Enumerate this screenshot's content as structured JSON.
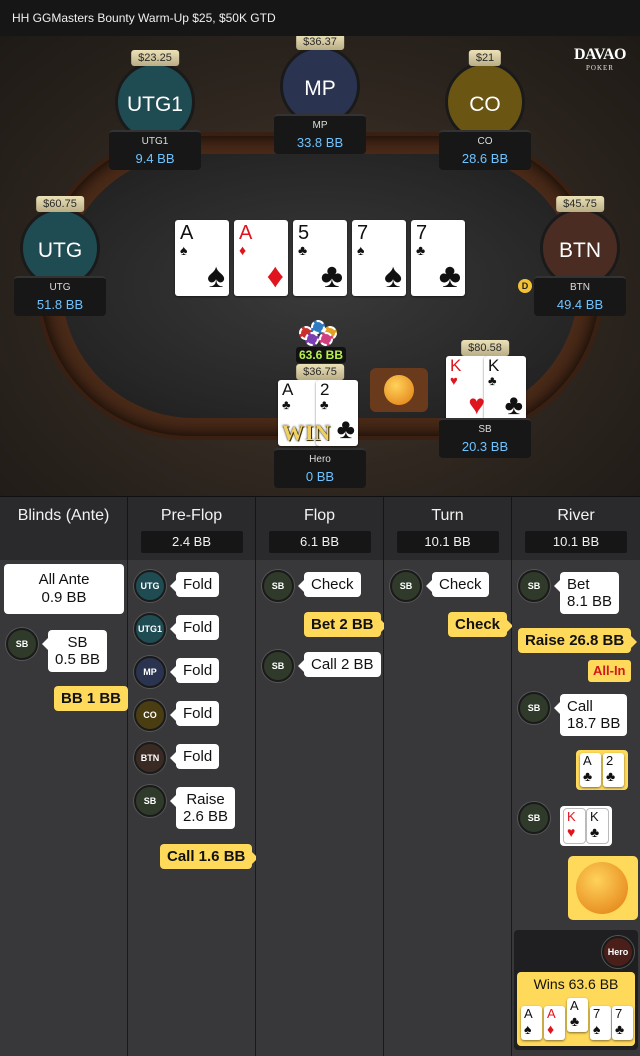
{
  "title": "HH  GGMasters Bounty Warm-Up $25, $50K GTD",
  "logo": {
    "line1": "DAVAO",
    "line2": "POKER"
  },
  "colors": {
    "accent_yellow": "#ffd95a",
    "bb_blue": "#6ec4ff",
    "pot_green": "#b8f04e",
    "allin_red": "#d01818"
  },
  "seats": {
    "utg1": {
      "avatar": "UTG1",
      "stack": "$23.25",
      "name": "UTG1",
      "bb": "9.4 BB",
      "color": "#1f4b52"
    },
    "mp": {
      "avatar": "MP",
      "stack": "$36.37",
      "name": "MP",
      "bb": "33.8 BB",
      "color": "#2a3350"
    },
    "co": {
      "avatar": "CO",
      "stack": "$21",
      "name": "CO",
      "bb": "28.6 BB",
      "color": "#6a5512"
    },
    "utg": {
      "avatar": "UTG",
      "stack": "$60.75",
      "name": "UTG",
      "bb": "51.8 BB",
      "color": "#1f4b52"
    },
    "btn": {
      "avatar": "BTN",
      "stack": "$45.75",
      "name": "BTN",
      "bb": "49.4 BB",
      "color": "#4a2c22"
    },
    "hero": {
      "stack": "$36.75",
      "name": "Hero",
      "bb": "0 BB"
    },
    "sb": {
      "stack": "$80.58",
      "name": "SB",
      "bb": "20.3 BB"
    }
  },
  "dealer_button": "D",
  "board": [
    {
      "rank": "A",
      "suit": "♠",
      "color": "black"
    },
    {
      "rank": "A",
      "suit": "♦",
      "color": "red"
    },
    {
      "rank": "5",
      "suit": "♣",
      "color": "black"
    },
    {
      "rank": "7",
      "suit": "♠",
      "color": "black"
    },
    {
      "rank": "7",
      "suit": "♣",
      "color": "black"
    }
  ],
  "pot": "63.6 BB",
  "hero_cards": [
    {
      "rank": "A",
      "suit": "♣"
    },
    {
      "rank": "2",
      "suit": "♣"
    }
  ],
  "hero_badge": "WIN",
  "sb_cards": [
    {
      "rank": "K",
      "suit": "♥"
    },
    {
      "rank": "K",
      "suit": "♣"
    }
  ],
  "streets": [
    {
      "name": "Blinds (Ante)",
      "pot": ""
    },
    {
      "name": "Pre-Flop",
      "pot": "2.4 BB"
    },
    {
      "name": "Flop",
      "pot": "6.1 BB"
    },
    {
      "name": "Turn",
      "pot": "10.1 BB"
    },
    {
      "name": "River",
      "pot": "10.1 BB"
    }
  ],
  "actions": {
    "blinds": {
      "all_ante_line1": "All Ante",
      "all_ante_line2": "0.9 BB",
      "sb_badge": "SB",
      "sb_line1": "SB",
      "sb_line2": "0.5 BB",
      "bb": "BB 1 BB"
    },
    "preflop": {
      "utg": "UTG",
      "utg_act": "Fold",
      "utg1": "UTG1",
      "utg1_act": "Fold",
      "mp": "MP",
      "mp_act": "Fold",
      "co": "CO",
      "co_act": "Fold",
      "btn": "BTN",
      "btn_act": "Fold",
      "sb": "SB",
      "sb_line1": "Raise",
      "sb_line2": "2.6 BB",
      "hero_act": "Call 1.6 BB"
    },
    "flop": {
      "sb1": "SB",
      "sb1_act": "Check",
      "hero_act": "Bet 2 BB",
      "sb2": "SB",
      "sb2_act": "Call 2 BB"
    },
    "turn": {
      "sb": "SB",
      "sb_act": "Check",
      "hero_act": "Check"
    },
    "river": {
      "sb1": "SB",
      "sb1_line1": "Bet",
      "sb1_line2": "8.1 BB",
      "hero_raise": "Raise 26.8 BB",
      "allin": "All-In",
      "sb2": "SB",
      "sb2_line1": "Call",
      "sb2_line2": "18.7 BB",
      "hero_show": [
        {
          "rank": "A",
          "suit": "♣"
        },
        {
          "rank": "2",
          "suit": "♣"
        }
      ],
      "sb3": "SB",
      "sb_show": [
        {
          "rank": "K",
          "suit": "♥"
        },
        {
          "rank": "K",
          "suit": "♣"
        }
      ],
      "hero_label": "Hero",
      "wins": "Wins 63.6 BB",
      "win_cards": [
        {
          "rank": "A",
          "suit": "♠",
          "color": "black"
        },
        {
          "rank": "A",
          "suit": "♦",
          "color": "red"
        },
        {
          "rank": "A",
          "suit": "♣",
          "color": "black"
        },
        {
          "rank": "7",
          "suit": "♠",
          "color": "black"
        },
        {
          "rank": "7",
          "suit": "♣",
          "color": "black"
        }
      ]
    }
  }
}
